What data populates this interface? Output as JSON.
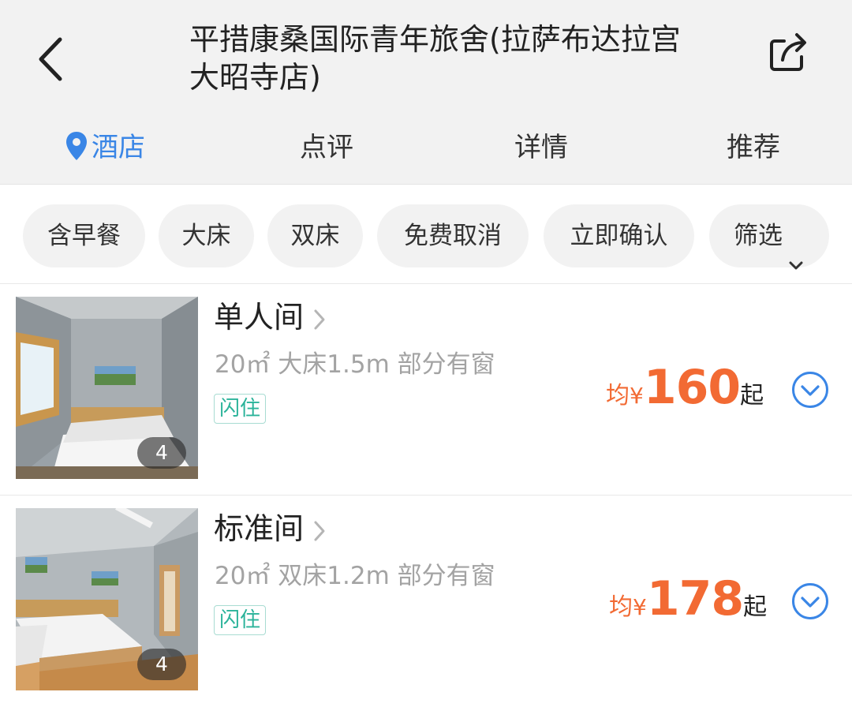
{
  "header": {
    "title": "平措康桑国际青年旅舍(拉萨布达拉宫大昭寺店)"
  },
  "tabs": [
    {
      "label": "酒店",
      "active": true
    },
    {
      "label": "点评"
    },
    {
      "label": "详情"
    },
    {
      "label": "推荐"
    }
  ],
  "filters": [
    "含早餐",
    "大床",
    "双床",
    "免费取消",
    "立即确认",
    "筛选"
  ],
  "rooms": [
    {
      "name": "单人间",
      "info": "20㎡ 大床1.5m 部分有窗",
      "badge": "闪住",
      "photo_count": "4",
      "price_prefix": "均",
      "currency": "¥",
      "price": "160",
      "price_suffix": "起"
    },
    {
      "name": "标准间",
      "info": "20㎡ 双床1.2m 部分有窗",
      "badge": "闪住",
      "photo_count": "4",
      "price_prefix": "均",
      "currency": "¥",
      "price": "178",
      "price_suffix": "起"
    }
  ],
  "colors": {
    "accent": "#3a86e6",
    "price": "#f26a33",
    "badge": "#2bb39a"
  },
  "icons": {
    "back": "back-arrow-icon",
    "share": "share-icon",
    "location": "location-pin-icon",
    "filter_dropdown": "chevron-down-icon",
    "room_detail": "chevron-right-icon",
    "expand": "chevron-circle-down-icon"
  }
}
